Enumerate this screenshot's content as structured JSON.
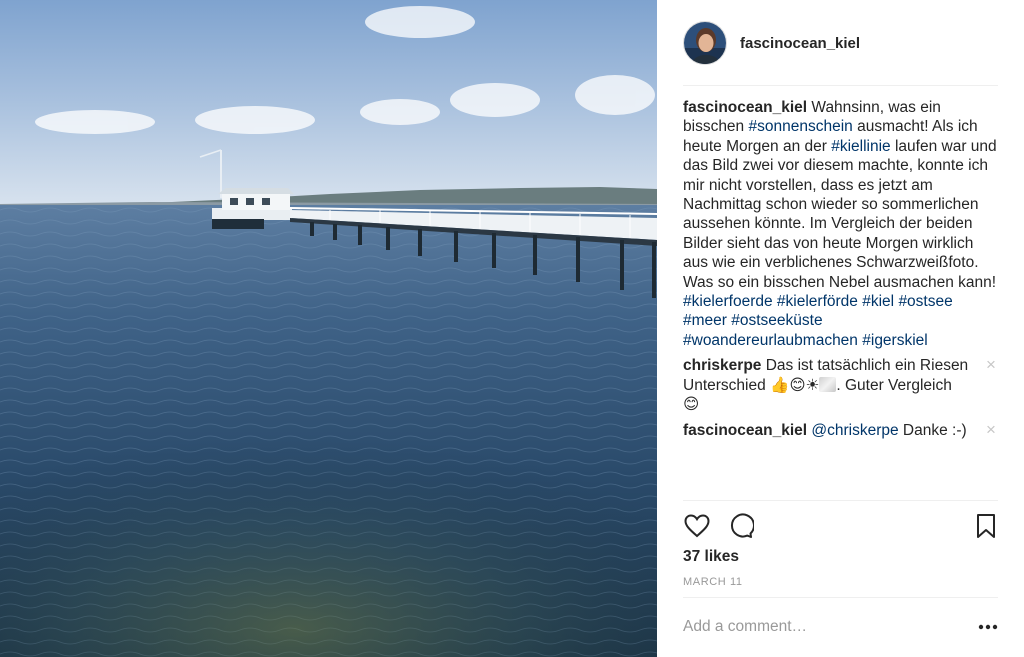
{
  "post": {
    "username": "fascinocean_kiel",
    "caption": {
      "username": "fascinocean_kiel",
      "t1": " Wahnsinn, was ein bisschen ",
      "tag_sonnenschein": "#sonnenschein",
      "t2": " ausmacht! Als ich heute Morgen an der ",
      "tag_kiellinie": "#kiellinie",
      "t3": " laufen war und das Bild zwei vor diesem machte, konnte ich mir nicht vorstellen, dass es jetzt am Nachmittag schon wieder so sommerlichen aussehen könnte. Im Vergleich der beiden Bilder sieht das von heute Morgen wirklich aus wie ein verblichenes Schwarzweißfoto. Was so ein bisschen Nebel ausmachen kann! ",
      "hashtags": [
        "#kielerfoerde",
        "#kielerförde",
        "#kiel",
        "#ostsee",
        "#meer",
        "#ostseeküste",
        "#woandereurlaubmachen",
        "#igerskiel"
      ]
    },
    "comments": [
      {
        "username": "chriskerpe",
        "text": " Das ist tatsächlich ein Riesen Unterschied ",
        "emojis": "👍😊☀",
        "text_end": ". Guter Vergleich ",
        "emoji_end": "😊",
        "delete_symbol": "×"
      },
      {
        "username": "fascinocean_kiel",
        "mention": "@chriskerpe",
        "text": " Danke :-)",
        "delete_symbol": "×"
      }
    ],
    "likes": "37 likes",
    "date": "MARCH 11",
    "add_comment_placeholder": "Add a comment…"
  },
  "colors": {
    "text": "#262626",
    "hashtag": "#003569",
    "muted": "#999999",
    "divider": "#efefef"
  },
  "icons": [
    "heart-icon",
    "comment-icon",
    "bookmark-icon",
    "more-options-icon",
    "close-icon"
  ]
}
